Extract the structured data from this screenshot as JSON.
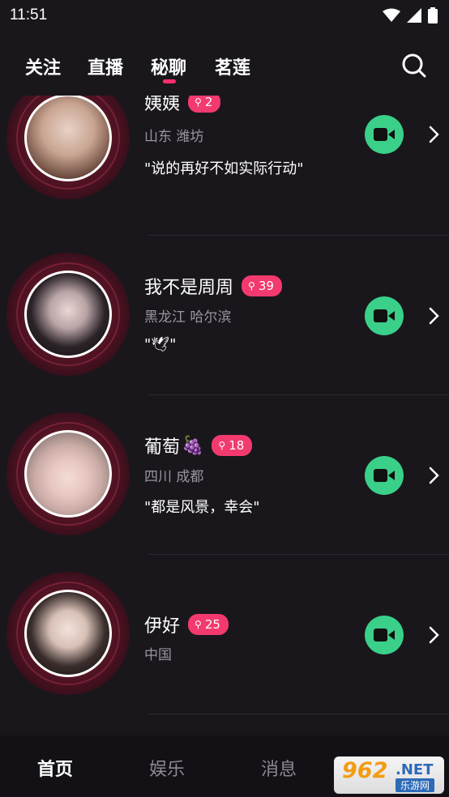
{
  "status_bar": {
    "time": "11:51"
  },
  "top_tabs": [
    {
      "label": "关注",
      "active": false
    },
    {
      "label": "直播",
      "active": false
    },
    {
      "label": "秘聊",
      "active": true
    },
    {
      "label": "茗莲",
      "active": false
    }
  ],
  "feed": [
    {
      "name": "姨姨",
      "emoji": "",
      "badge_count": "2",
      "location": "山东 潍坊",
      "signature": "\"说的再好不如实际行动\""
    },
    {
      "name": "我不是周周",
      "emoji": "",
      "badge_count": "39",
      "location": "黑龙江 哈尔滨",
      "signature": "\"🕊\""
    },
    {
      "name": "葡萄",
      "emoji": "🍇",
      "badge_count": "18",
      "location": "四川 成都",
      "signature": "\"都是风景，幸会\""
    },
    {
      "name": "伊好",
      "emoji": "",
      "badge_count": "25",
      "location": "中国",
      "signature": ""
    }
  ],
  "bottom_nav": [
    {
      "label": "首页",
      "active": true
    },
    {
      "label": "娱乐",
      "active": false
    },
    {
      "label": "消息",
      "active": false
    }
  ],
  "watermark": {
    "number": "962",
    "suffix": ".NET",
    "site": "乐游网"
  },
  "colors": {
    "accent": "#ff2d6d",
    "badge": "#f23a6e",
    "video": "#3ad08a",
    "background": "#1a171c"
  }
}
